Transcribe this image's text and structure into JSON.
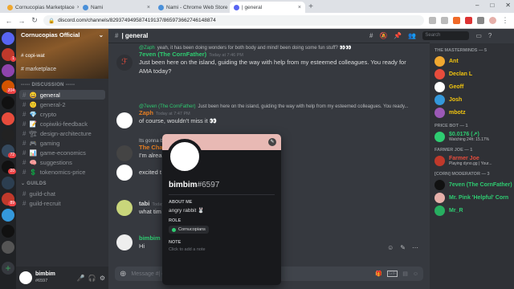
{
  "browser": {
    "tabs": [
      {
        "label": "Cornucopias Marketplace",
        "color": "#f0a830"
      },
      {
        "label": "Nami",
        "color": "#4a90d9"
      },
      {
        "label": "Nami - Chrome Web Store",
        "color": "#4a90d9"
      },
      {
        "label": "| general",
        "color": "#5865f2"
      }
    ],
    "url": "discord.com/channels/829374949587419137/865973662746148874"
  },
  "server": {
    "name": "Cornucopias Official",
    "banner_caption": "copi-wat",
    "top_channel": "marketplace"
  },
  "categories": {
    "discussion": "----- DISCUSSION -----",
    "guilds": "GUILDS"
  },
  "channels": [
    {
      "icon": "😀",
      "label": "general",
      "selected": true
    },
    {
      "icon": "🙂",
      "label": "general-2"
    },
    {
      "icon": "💎",
      "label": "crypto"
    },
    {
      "icon": "📝",
      "label": "copiwiki-feedback"
    },
    {
      "icon": "🏗",
      "label": "design-architecture"
    },
    {
      "icon": "🎮",
      "label": "gaming"
    },
    {
      "icon": "📊",
      "label": "game-economics"
    },
    {
      "icon": "🧠",
      "label": "suggestions"
    },
    {
      "icon": "💲",
      "label": "tokenomics-price"
    }
  ],
  "guild_channels": [
    {
      "label": "guild-chat"
    },
    {
      "label": "guild-recruit"
    }
  ],
  "user": {
    "name": "bimbim",
    "tag": "#6597"
  },
  "header": {
    "channel": "| general",
    "search_placeholder": "Search"
  },
  "messages": [
    {
      "reply_to": "@Zaph",
      "reply_text": "yeah, it has been doing wonders for both body and mind! been doing some fun stuff? 👀👀",
      "author": "7even (The CornFather)",
      "author_color": "#2ecc71",
      "time": "Today at 7:46 PM",
      "lines": [
        "Just been here on the island, guiding the way with help from my esteemed colleagues. You ready for",
        "AMA today?"
      ]
    },
    {
      "reply_to": "@7even (The CornFather)",
      "reply_text": "Just been here on the island, guiding the way with help from my esteemed colleagues. You ready...",
      "author": "Zaph",
      "author_color": "#e67e22",
      "time": "Today at 7:47 PM",
      "lines": [
        "of course, wouldn't miss it 👀"
      ]
    },
    {
      "reply_to": "",
      "reply_text": "Its gonna be a historic moment testing new tech fro...",
      "author": "The Cha",
      "author_color": "#e67e22",
      "time": "",
      "lines": [
        "I'm alrea                                                            othest mint I experienced tbvh. 😊"
      ]
    },
    {
      "reply_to": "",
      "reply_text": "",
      "author": "",
      "author_color": "#dcddde",
      "time": "",
      "lines": [
        "excited t                                                            been up to on the island!"
      ]
    },
    {
      "reply_to": "",
      "reply_text": "",
      "author": "tabi",
      "author_color": "#dcddde",
      "time": "Today at",
      "lines": [
        "what tim"
      ]
    },
    {
      "reply_to": "",
      "reply_text": "",
      "author": "bimbim",
      "author_color": "#2ecc71",
      "time": "",
      "lines": [
        "Hi"
      ]
    }
  ],
  "composer": {
    "placeholder": "Message #| general"
  },
  "members": {
    "groups": [
      {
        "title": "THE MASTERMINDS — 5",
        "items": [
          {
            "name": "Ant",
            "color": "#f1c40f",
            "sub": ""
          },
          {
            "name": "Declan L",
            "color": "#f1c40f",
            "sub": ""
          },
          {
            "name": "Geoff",
            "color": "#f1c40f",
            "sub": ""
          },
          {
            "name": "Josh",
            "color": "#f1c40f",
            "sub": ""
          },
          {
            "name": "mbotz",
            "color": "#f1c40f",
            "sub": ""
          }
        ]
      },
      {
        "title": "PRICE BOT — 1",
        "items": [
          {
            "name": "$0.0176 (↗)",
            "color": "#2ecc71",
            "sub": "Watching 24h: 15.17%"
          }
        ]
      },
      {
        "title": "FARMER JOE — 1",
        "items": [
          {
            "name": "Farmer Joe",
            "color": "#e74c3c",
            "sub": "Playing dyno.gg | Your..."
          }
        ]
      },
      {
        "title": "[CORN] MODERATOR — 3",
        "items": [
          {
            "name": "7even (The CornFather)",
            "color": "#2ecc71",
            "sub": ""
          },
          {
            "name": "Mr. Pink 'Helpful' Corn",
            "color": "#2ecc71",
            "sub": ""
          },
          {
            "name": "Mr_R",
            "color": "#2ecc71",
            "sub": ""
          }
        ]
      }
    ]
  },
  "popup": {
    "username": "bimbim",
    "discriminator": "#6597",
    "about_label": "ABOUT ME",
    "about_text": "angry rabbit 🐰",
    "role_label": "ROLE",
    "role": "Cornucopians",
    "role_color": "#2ecc71",
    "note_label": "NOTE",
    "note_placeholder": "Click to add a note"
  },
  "colors": {
    "accent": "#5865f2",
    "banner": "#e8b9b4"
  }
}
